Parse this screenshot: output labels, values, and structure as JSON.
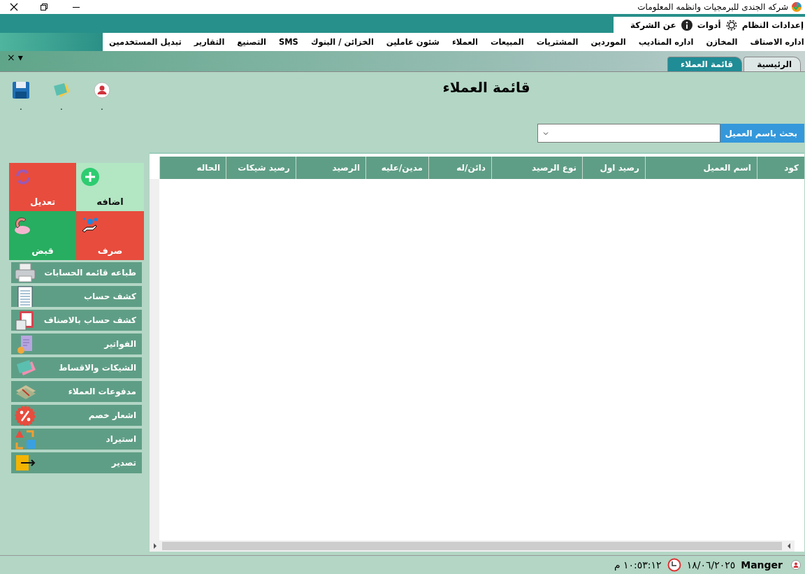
{
  "window": {
    "title": "شركه الجندى للبرمجيات وانظمه المعلومات"
  },
  "top_menu": [
    {
      "label": "إعدادات النظام"
    },
    {
      "label": "أدوات"
    },
    {
      "label": "عن الشركة"
    }
  ],
  "menu": [
    {
      "label": "اداره الاصناف"
    },
    {
      "label": "المخازن"
    },
    {
      "label": "اداره المناديب"
    },
    {
      "label": "الموردين"
    },
    {
      "label": "المشتريات"
    },
    {
      "label": "المبيعات"
    },
    {
      "label": "العملاء"
    },
    {
      "label": "شئون عاملين"
    },
    {
      "label": "الخزائن / البنوك"
    },
    {
      "label": "SMS"
    },
    {
      "label": "التصنيع"
    },
    {
      "label": "التقارير"
    },
    {
      "label": "تبديل المستخدمين"
    }
  ],
  "tab_strip": {
    "close": "×",
    "dropdown": "▾"
  },
  "tabs": [
    {
      "label": "الرئيسية",
      "selected": false
    },
    {
      "label": "قائمة العملاء",
      "selected": true
    }
  ],
  "page_title": "قائمة العملاء",
  "toolbar": [
    {
      "caption": "."
    },
    {
      "caption": "."
    },
    {
      "caption": "."
    }
  ],
  "search": {
    "label": "بحث باسم العميل"
  },
  "table": {
    "columns": [
      "كود",
      "اسم العميل",
      "رصيد اول",
      "نوع الرصيد",
      "دائن/له",
      "مدين/عليه",
      "الرصيد",
      "رصيد شيكات",
      "الحاله"
    ]
  },
  "tiles": [
    {
      "label": "اضافه",
      "color": "#b3e6c3"
    },
    {
      "label": "تعديل",
      "color": "#e84c3d"
    },
    {
      "label": "صرف",
      "color": "#e84c3d"
    },
    {
      "label": "قبض",
      "color": "#27ae60"
    }
  ],
  "actions": [
    {
      "label": "طباعه قائمه الحسابات"
    },
    {
      "label": "كشف حساب"
    },
    {
      "label": "كشف حساب بالاصناف"
    },
    {
      "label": "الفواتير"
    },
    {
      "label": "الشيكات والاقساط"
    },
    {
      "label": "مدفوعات العملاء"
    },
    {
      "label": "اشعار خصم"
    },
    {
      "label": "استيراد"
    },
    {
      "label": "تصدير"
    }
  ],
  "status_bar": {
    "user": "Manger",
    "date": "١٨/٠٦/٢٠٢٥",
    "time": "١٠:٥٣:١٢ م"
  }
}
